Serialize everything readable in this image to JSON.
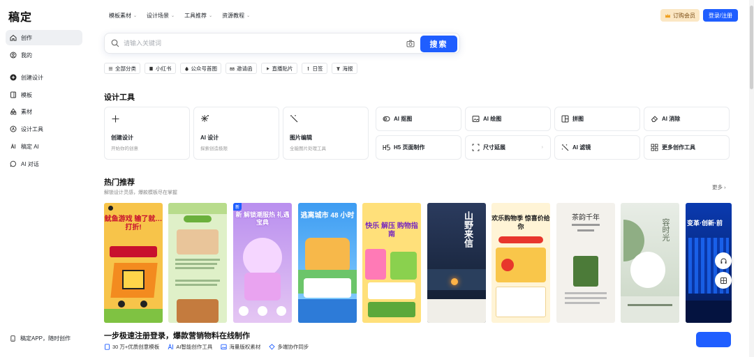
{
  "brand": {
    "logo": "稿定"
  },
  "sidebar": {
    "items": [
      {
        "label": "创作",
        "icon": "home-icon"
      },
      {
        "label": "我的",
        "icon": "user-icon"
      },
      {
        "label": "创建设计",
        "icon": "plus-circle-icon"
      },
      {
        "label": "模板",
        "icon": "template-icon"
      },
      {
        "label": "素材",
        "icon": "shapes-icon"
      },
      {
        "label": "设计工具",
        "icon": "tools-icon"
      },
      {
        "label": "稿定 AI",
        "icon": "ai-icon"
      },
      {
        "label": "AI 对话",
        "icon": "chat-icon"
      }
    ],
    "bottom": "稿定APP，随时创作"
  },
  "topnav": {
    "items": [
      "模板素材",
      "设计场景",
      "工具推荐",
      "资源教程"
    ],
    "vip_label": "订购会员",
    "login_label": "登录/注册"
  },
  "search": {
    "placeholder": "请输入关键词",
    "button_label": "搜索"
  },
  "categories": [
    {
      "label": "全部分类",
      "icon": "menu-icon"
    },
    {
      "label": "小红书",
      "icon": "book-icon"
    },
    {
      "label": "公众号首图",
      "icon": "drop-icon"
    },
    {
      "label": "邀请函",
      "icon": "invite-icon"
    },
    {
      "label": "直播贴片",
      "icon": "play-icon"
    },
    {
      "label": "日签",
      "icon": "calendar-icon"
    },
    {
      "label": "海报",
      "icon": "poster-icon"
    }
  ],
  "tools": {
    "title": "设计工具",
    "big": [
      {
        "title": "创建设计",
        "desc": "开始你的创意",
        "icon": "plus-icon"
      },
      {
        "title": "AI 设计",
        "desc": "探索创造极限",
        "icon": "sparkle-icon"
      },
      {
        "title": "图片编辑",
        "desc": "全能图片处理工具",
        "icon": "magic-wand-icon"
      }
    ],
    "small": [
      {
        "label": "AI 抠图",
        "icon": "cutout-icon"
      },
      {
        "label": "AI 绘图",
        "icon": "image-icon"
      },
      {
        "label": "拼图",
        "icon": "collage-icon"
      },
      {
        "label": "AI 消除",
        "icon": "eraser-icon"
      },
      {
        "label": "H5 页面制作",
        "icon": "h5-icon"
      },
      {
        "label": "尺寸延展",
        "icon": "resize-icon"
      },
      {
        "label": "AI 滤镜",
        "icon": "filter-icon"
      },
      {
        "label": "更多创作工具",
        "icon": "grid-icon"
      }
    ]
  },
  "hot": {
    "title": "热门推荐",
    "subtitle": "解锁设计灵感，爆款模板尽在掌握",
    "more_label": "更多",
    "templates": [
      {
        "text": "鱿鱼游戏 输了就…打折!",
        "bg": "#f7c44a"
      },
      {
        "text": "",
        "bg": "#dff0c8"
      },
      {
        "text": "新 解锁潮服热 礼遇宝典",
        "bg": "#c9a7f2"
      },
      {
        "text": "逃离城市 48 小时",
        "bg": "#54a8f0"
      },
      {
        "text": "快乐 解压 购物指南",
        "bg": "#ffe07a"
      },
      {
        "text": "山野来信",
        "bg": "#1c2a44"
      },
      {
        "text": "欢乐购物季 惊喜价给你",
        "bg": "#fff4d6"
      },
      {
        "text": "茶韵千年",
        "bg": "#f3f1ec"
      },
      {
        "text": "容时光",
        "bg": "#dfe6dc"
      },
      {
        "text": "变革·创新·前",
        "bg": "#0c2e8a"
      }
    ]
  },
  "banner": {
    "title": "一步极速注册登录，爆款营销物料在线制作",
    "features": [
      {
        "label": "30 万+优质创意模板",
        "icon": "doc-icon"
      },
      {
        "label": "AI智能创作工具",
        "icon": "ai-icon"
      },
      {
        "label": "海量版权素材",
        "icon": "image-icon"
      },
      {
        "label": "多端协作同步",
        "icon": "sync-icon"
      }
    ]
  },
  "colors": {
    "accent": "#1f5eff",
    "vip": "#fbe7c4"
  }
}
